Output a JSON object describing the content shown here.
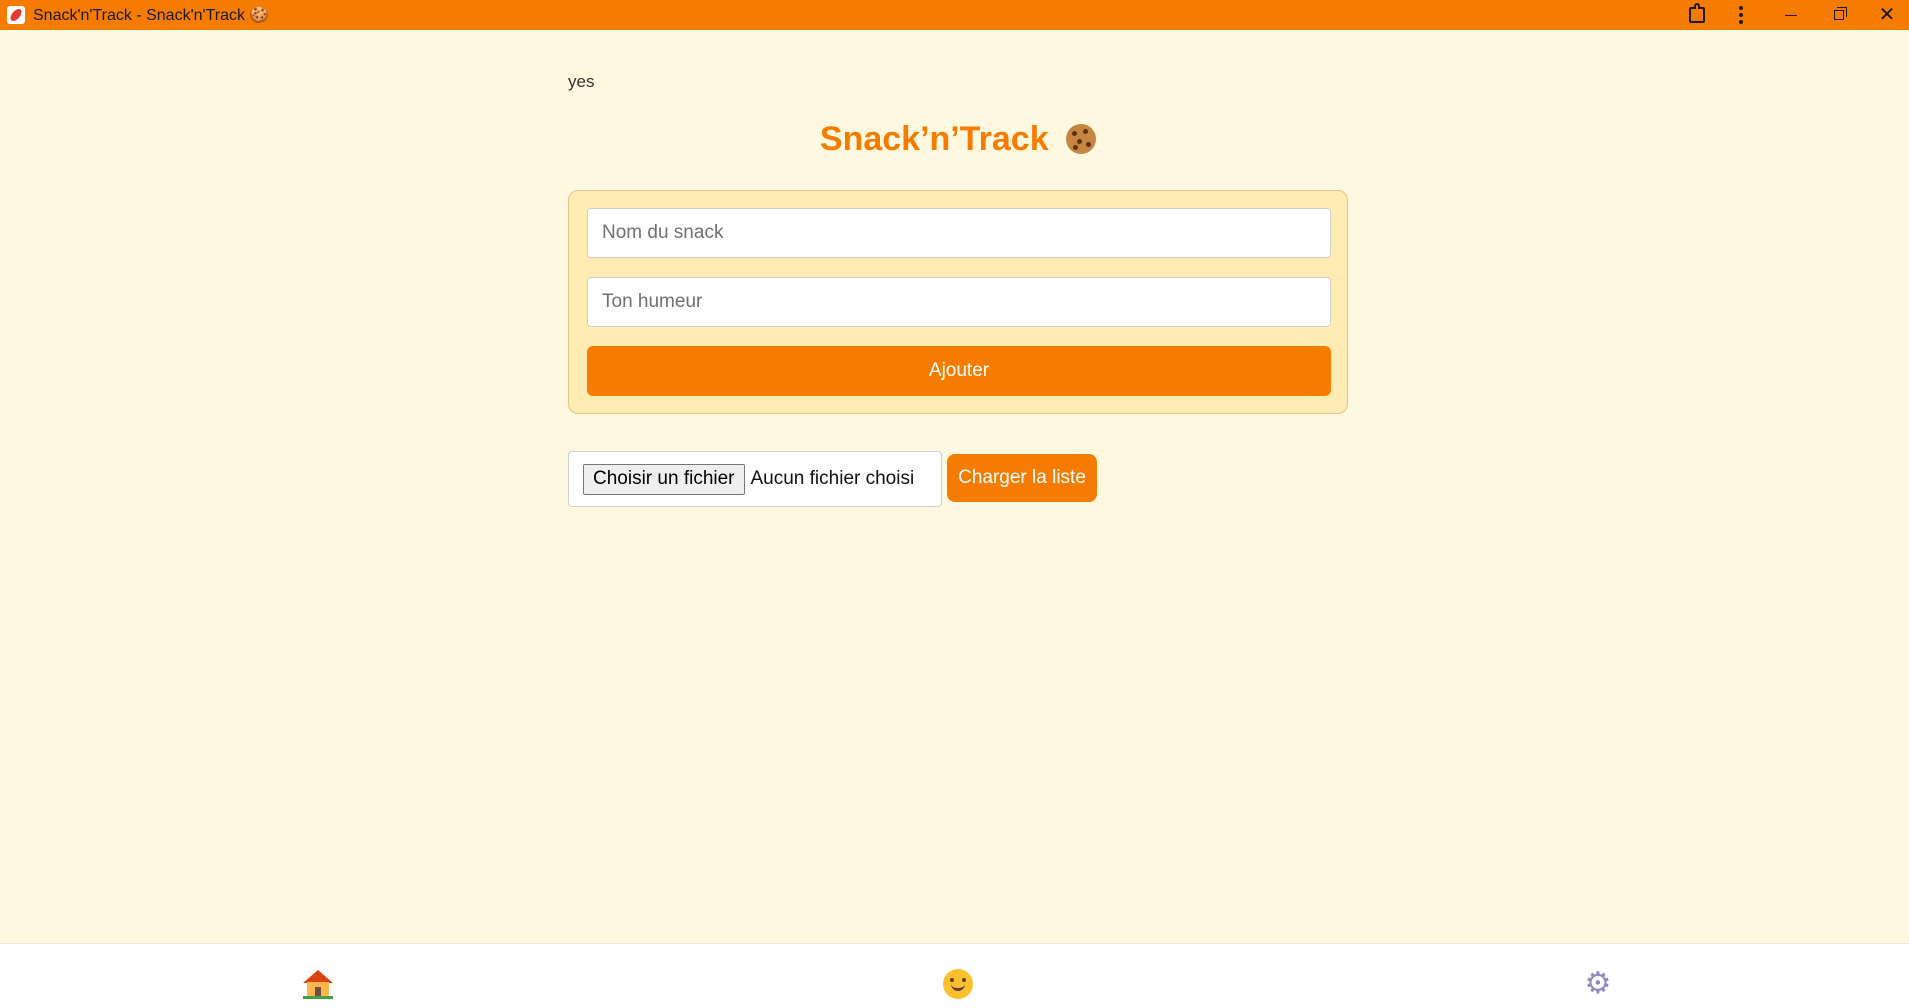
{
  "window": {
    "title": "Snack'n'Track - Snack'n'Track 🍪",
    "icons": [
      "app-icon",
      "extensions-icon",
      "more-options-icon",
      "minimize-icon",
      "maximize-icon",
      "close-icon"
    ],
    "close_glyph": "✕"
  },
  "main": {
    "status_text": "yes",
    "title": "Snack’n’Track",
    "title_icon": "cookie-icon"
  },
  "form": {
    "snack_placeholder": "Nom du snack",
    "snack_value": "",
    "mood_placeholder": "Ton humeur",
    "mood_value": "",
    "add_label": "Ajouter"
  },
  "file": {
    "choose_label": "Choisir un fichier",
    "status": "Aucun fichier choisi",
    "load_label": "Charger la liste"
  },
  "nav": {
    "items": [
      {
        "name": "home",
        "icon": "home-icon"
      },
      {
        "name": "mood",
        "icon": "smile-icon"
      },
      {
        "name": "settings",
        "icon": "gear-icon",
        "glyph": "⚙"
      }
    ]
  },
  "colors": {
    "accent": "#f57c00",
    "background": "#fff8e1",
    "card": "#ffecb3"
  }
}
